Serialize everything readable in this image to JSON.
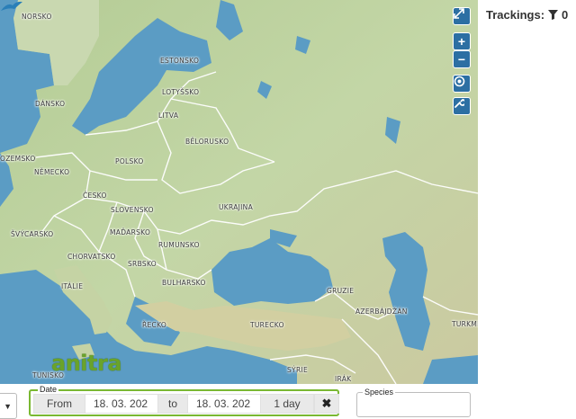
{
  "map": {
    "country_labels": [
      {
        "key": "norsko",
        "text": "NORSKO"
      },
      {
        "key": "estonsko",
        "text": "ESTONSKO"
      },
      {
        "key": "lotyssko",
        "text": "LOTYŠSKO"
      },
      {
        "key": "dansko",
        "text": "DÁNSKO"
      },
      {
        "key": "litva",
        "text": "LITVA"
      },
      {
        "key": "belorusko",
        "text": "BĚLORUSKO"
      },
      {
        "key": "ozemsko",
        "text": "OZEMSKO"
      },
      {
        "key": "nemecko",
        "text": "NĚMECKO"
      },
      {
        "key": "polsko",
        "text": "POLSKO"
      },
      {
        "key": "cesko",
        "text": "ČESKO"
      },
      {
        "key": "slovensko",
        "text": "SLOVENSKO"
      },
      {
        "key": "ukrajina",
        "text": "UKRAJINA"
      },
      {
        "key": "svycarsko",
        "text": "ŠVÝCARSKO"
      },
      {
        "key": "madarsko",
        "text": "MAĎARSKO"
      },
      {
        "key": "rumunsko",
        "text": "RUMUNSKO"
      },
      {
        "key": "chorvatsko",
        "text": "CHORVATSKO"
      },
      {
        "key": "srbsko",
        "text": "SRBSKO"
      },
      {
        "key": "italie",
        "text": "ITÁLIE"
      },
      {
        "key": "bulharsko",
        "text": "BULHARSKO"
      },
      {
        "key": "gruzie",
        "text": "GRUZIE"
      },
      {
        "key": "azerbajdzan",
        "text": "AZERBÁJDŽÁN"
      },
      {
        "key": "turkmen",
        "text": "TURKME"
      },
      {
        "key": "recko",
        "text": "ŘECKO"
      },
      {
        "key": "turecko",
        "text": "TURECKO"
      },
      {
        "key": "syrie",
        "text": "SÝRIE"
      },
      {
        "key": "irak",
        "text": "IRÁK"
      },
      {
        "key": "tunisko",
        "text": "TUNISKO"
      }
    ],
    "controls": {
      "fullscreen_icon": "expand-arrows-icon",
      "zoom_in_label": "+",
      "zoom_out_label": "−",
      "locate_icon": "target-icon",
      "settings_icon": "wrench-icon"
    },
    "logo_text": "anitra",
    "colors": {
      "water": "#5b9cc4",
      "land": "#b9cf9d",
      "accent": "#2c6fa3"
    }
  },
  "sidebar": {
    "title": "Trackings:",
    "filter_icon": "filter-icon",
    "count": "0"
  },
  "filters": {
    "date": {
      "legend": "Date",
      "from_label": "From",
      "from_value": "18. 03. 202",
      "to_label": "to",
      "to_value": "18. 03. 202",
      "range_label": "1 day",
      "clear_icon": "close-icon"
    },
    "species": {
      "legend": "Species",
      "value": ""
    },
    "accent_color": "#7ab832"
  }
}
